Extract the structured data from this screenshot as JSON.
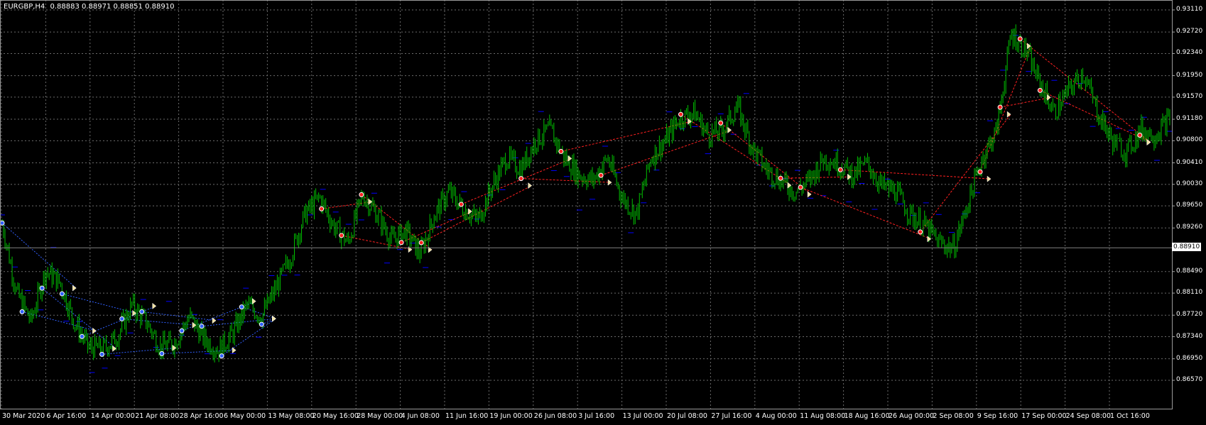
{
  "window": {
    "symbol_title": "EURGBP,H4",
    "ohlc": "0.88883 0.88971 0.88851 0.88910"
  },
  "colors": {
    "background": "#000000",
    "grid": "#6b6b6b",
    "candles": "#00c000",
    "axis_text": "#ffffff",
    "bid_line": "#808080",
    "buy_marker": "#3060ff",
    "sell_marker": "#ff2020",
    "close_marker": "#f0e0a0",
    "buy_link": "#3060ff",
    "sell_link": "#ff2020",
    "level_dash": "#0000ff"
  },
  "y_axis": {
    "ticks": [
      "0.93110",
      "0.92720",
      "0.92340",
      "0.91950",
      "0.91570",
      "0.91180",
      "0.90800",
      "0.90410",
      "0.90030",
      "0.89650",
      "0.89260",
      "0.88490",
      "0.88110",
      "0.87720",
      "0.87340",
      "0.86950",
      "0.86570"
    ],
    "current_price": "0.88910"
  },
  "x_axis": {
    "ticks": [
      "30 Mar 2020",
      "6 Apr 16:00",
      "14 Apr 00:00",
      "21 Apr 08:00",
      "28 Apr 16:00",
      "6 May 00:00",
      "13 May 08:00",
      "20 May 16:00",
      "28 May 00:00",
      "4 Jun 08:00",
      "11 Jun 16:00",
      "19 Jun 00:00",
      "26 Jun 08:00",
      "3 Jul 16:00",
      "13 Jul 00:00",
      "20 Jul 08:00",
      "27 Jul 16:00",
      "4 Aug 00:00",
      "11 Aug 08:00",
      "18 Aug 16:00",
      "26 Aug 00:00",
      "2 Sep 08:00",
      "9 Sep 16:00",
      "17 Sep 00:00",
      "24 Sep 08:00",
      "1 Oct 16:00"
    ]
  },
  "chart_data": {
    "type": "candlestick",
    "symbol": "EURGBP",
    "timeframe": "H4",
    "ylim": [
      0.8657,
      0.9311
    ],
    "x": [
      "30 Mar 2020",
      "6 Apr 16:00",
      "14 Apr 00:00",
      "21 Apr 08:00",
      "28 Apr 16:00",
      "6 May 00:00",
      "13 May 08:00",
      "20 May 16:00",
      "28 May 00:00",
      "4 Jun 08:00",
      "11 Jun 16:00",
      "19 Jun 00:00",
      "26 Jun 08:00",
      "3 Jul 16:00",
      "13 Jul 00:00",
      "20 Jul 08:00",
      "27 Jul 16:00",
      "4 Aug 00:00",
      "11 Aug 08:00",
      "18 Aug 16:00",
      "26 Aug 00:00",
      "2 Sep 08:00",
      "9 Sep 16:00",
      "17 Sep 00:00",
      "24 Sep 08:00",
      "1 Oct 16:00"
    ],
    "close_path": [
      0.8935,
      0.8812,
      0.8762,
      0.885,
      0.883,
      0.876,
      0.8715,
      0.8712,
      0.8735,
      0.879,
      0.876,
      0.8715,
      0.8725,
      0.877,
      0.873,
      0.871,
      0.874,
      0.879,
      0.877,
      0.882,
      0.8875,
      0.895,
      0.898,
      0.893,
      0.89,
      0.8985,
      0.895,
      0.8905,
      0.892,
      0.888,
      0.895,
      0.899,
      0.896,
      0.894,
      0.9,
      0.905,
      0.903,
      0.908,
      0.91,
      0.905,
      0.902,
      0.901,
      0.905,
      0.898,
      0.895,
      0.905,
      0.908,
      0.912,
      0.913,
      0.909,
      0.91,
      0.914,
      0.907,
      0.903,
      0.901,
      0.899,
      0.901,
      0.905,
      0.904,
      0.902,
      0.904,
      0.9,
      0.899,
      0.895,
      0.893,
      0.89,
      0.889,
      0.897,
      0.905,
      0.91,
      0.927,
      0.924,
      0.918,
      0.913,
      0.917,
      0.92,
      0.913,
      0.908,
      0.906,
      0.91,
      0.909,
      0.912
    ],
    "trades": [
      {
        "side": "buy",
        "entry": 0.882,
        "close": 0.882
      },
      {
        "side": "sell",
        "entry": 0.91,
        "close": 0.906
      }
    ]
  }
}
